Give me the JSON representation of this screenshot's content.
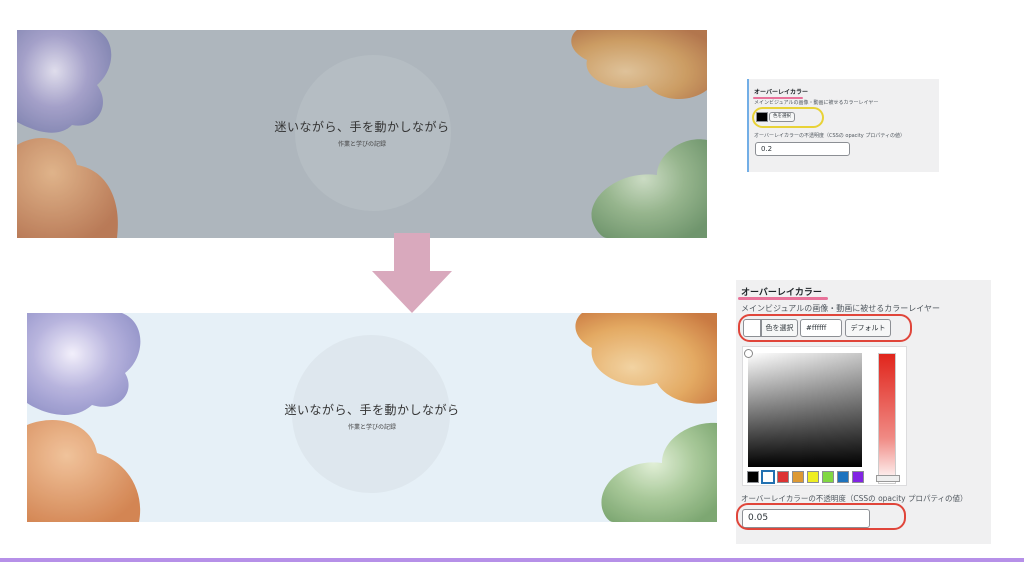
{
  "colors": {
    "arrow": "#d9a9bd",
    "highlight_red": "#e0453a",
    "highlight_yellow": "#e8d237",
    "underline_pink": "#e8739a",
    "overlay_before": "#bcc5cc",
    "overlay_after": "#e9f3f8",
    "bottom_line": "#b690e8"
  },
  "before": {
    "hero": {
      "title": "迷いながら、手を動かしながら",
      "subtitle": "作業と学びの記録"
    },
    "settings": {
      "title": "オーバーレイカラー",
      "description": "メインビジュアルの画像・動画に被せるカラーレイヤー",
      "color_button_label": "色を選択",
      "selected_color": "#000000",
      "opacity_label": "オーバーレイカラーの不透明度（CSSの opacity プロパティの値）",
      "opacity_value": "0.2"
    }
  },
  "arrow_icon": "down-arrow-icon",
  "after": {
    "hero": {
      "title": "迷いながら、手を動かしながら",
      "subtitle": "作業と学びの記録"
    },
    "settings": {
      "title": "オーバーレイカラー",
      "description": "メインビジュアルの画像・動画に被せるカラーレイヤー",
      "color_button_label": "色を選択",
      "selected_color": "#ffffff",
      "hex_value": "#ffffff",
      "default_button_label": "デフォルト",
      "picker_swatches": [
        "#000000",
        "#ffffff",
        "#dd3333",
        "#dd9933",
        "#eeee22",
        "#81d742",
        "#1e73be",
        "#8224e3"
      ],
      "opacity_label": "オーバーレイカラーの不透明度（CSSの opacity プロパティの値）",
      "opacity_value": "0.05"
    }
  }
}
